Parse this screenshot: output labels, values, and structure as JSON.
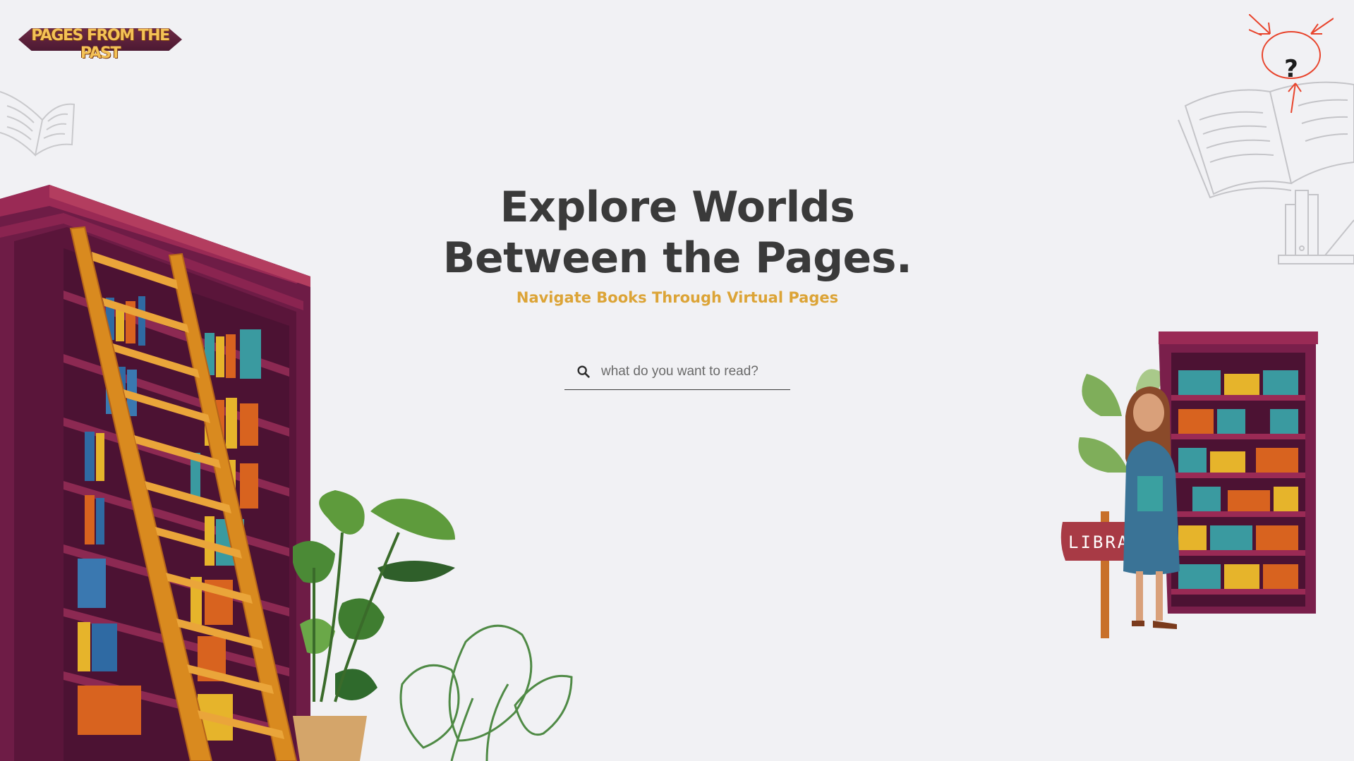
{
  "brand": {
    "logo_text": "PAGES FROM THE PAST"
  },
  "help": {
    "label": "?"
  },
  "hero": {
    "title_line1": "Explore Worlds",
    "title_line2": "Between the Pages.",
    "subtitle": "Navigate Books Through Virtual Pages"
  },
  "search": {
    "placeholder": "what do you want to read?",
    "value": ""
  },
  "library_sign": {
    "text": "LIBRA"
  },
  "colors": {
    "background": "#f1f1f4",
    "heading": "#3a3a3a",
    "accent": "#dca437",
    "shelf": "#7a1f4b",
    "annotation": "#e8442c"
  },
  "icons": {
    "search": "search-icon",
    "help": "question-mark-icon"
  }
}
